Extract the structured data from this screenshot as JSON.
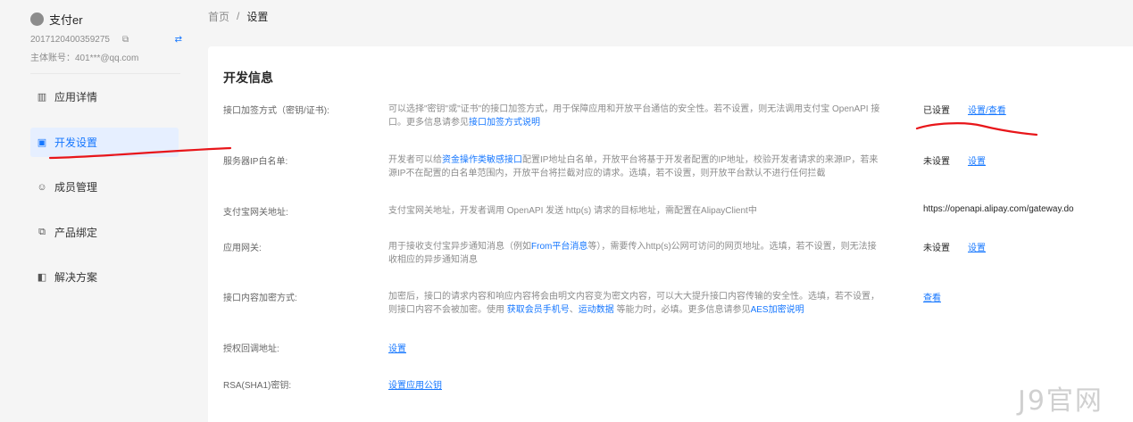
{
  "app": {
    "name": "支付er",
    "app_id": "2017120400359275",
    "account": "主体账号：401***@qq.com"
  },
  "icons": {
    "copy": "copy-icon",
    "swap": "swap-icon"
  },
  "nav": {
    "items": [
      {
        "label": "应用详情",
        "icon": "monitor-icon",
        "glyph": "▥"
      },
      {
        "label": "开发设置",
        "icon": "dev-settings-icon",
        "glyph": "▣"
      },
      {
        "label": "成员管理",
        "icon": "members-icon",
        "glyph": "☺"
      },
      {
        "label": "产品绑定",
        "icon": "product-bind-icon",
        "glyph": "⧉"
      },
      {
        "label": "解决方案",
        "icon": "solution-icon",
        "glyph": "◧"
      }
    ],
    "active_index": 1
  },
  "breadcrumb": {
    "home": "首页",
    "separator": "/",
    "current": "设置"
  },
  "section": {
    "title": "开发信息"
  },
  "rows": {
    "sign": {
      "label": "接口加签方式（密钥/证书):",
      "desc_1": "可以选择\"密钥\"或\"证书\"的接口加签方式，用于保障应用和开放平台通信的安全性。若不设置，则无法调用支付宝 OpenAPI 接口。更多信息请参见",
      "desc_link": "接口加签方式说明",
      "status": "已设置",
      "action": "设置/查看"
    },
    "ip": {
      "label": "服务器IP白名单:",
      "desc_1": "开发者可以给",
      "desc_link": "资金操作类敏感接口",
      "desc_2": "配置IP地址白名单，开放平台将基于开发者配置的IP地址，校验开发者请求的来源IP，若来源IP不在配置的白名单范围内，开放平台将拦截对应的请求。选填，若不设置，则开放平台默认不进行任何拦截",
      "status": "未设置",
      "action": "设置"
    },
    "gateway": {
      "label": "支付宝网关地址:",
      "desc": "支付宝网关地址，开发者调用 OpenAPI 发送 http(s) 请求的目标地址，需配置在AlipayClient中",
      "value": "https://openapi.alipay.com/gateway.do"
    },
    "app_gateway": {
      "label": "应用网关:",
      "desc_1": "用于接收支付宝异步通知消息（例如",
      "desc_link": "From平台消息",
      "desc_2": "等），需要传入http(s)公网可访问的网页地址。选填，若不设置，则无法接收相应的异步通知消息",
      "status": "未设置",
      "action": "设置"
    },
    "encrypt": {
      "label": "接口内容加密方式:",
      "desc_1": "加密后，接口的请求内容和响应内容将会由明文内容变为密文内容，可以大大提升接口内容传输的安全性。选填，若不设置，则接口内容不会被加密。使用 ",
      "desc_link_1": "获取会员手机号",
      "desc_sep": "、",
      "desc_link_2": "运动数据",
      "desc_2": " 等能力时，必填。更多信息请参见",
      "desc_link_3": "AES加密说明",
      "action": "查看"
    },
    "callback": {
      "label": "授权回调地址:",
      "action": "设置"
    },
    "rsa": {
      "label": "RSA(SHA1)密钥:",
      "action": "设置应用公钥"
    }
  },
  "watermark": "J9官网",
  "annotation_color": "#e8161a"
}
